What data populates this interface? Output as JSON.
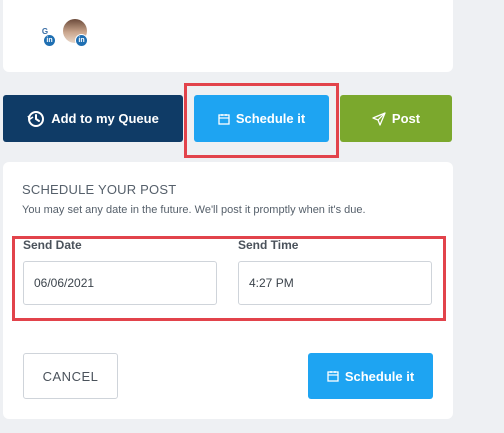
{
  "profiles": [
    {
      "name": "profile-1",
      "initials": "G",
      "network": "in"
    },
    {
      "name": "profile-2",
      "initials": "",
      "network": "in"
    }
  ],
  "actions": {
    "queue_label": "Add to my Queue",
    "schedule_label": "Schedule it",
    "post_label": "Post"
  },
  "schedule": {
    "title": "SCHEDULE YOUR POST",
    "description": "You may set any date in the future. We'll post it promptly when it's due.",
    "date_label": "Send Date",
    "date_value": "06/06/2021",
    "time_label": "Send Time",
    "time_value": "4:27 PM",
    "cancel_label": "CANCEL",
    "submit_label": "Schedule it"
  },
  "colors": {
    "queue": "#0f3b66",
    "schedule": "#1ea4f2",
    "post": "#7ba82d",
    "highlight": "#e2434b"
  }
}
